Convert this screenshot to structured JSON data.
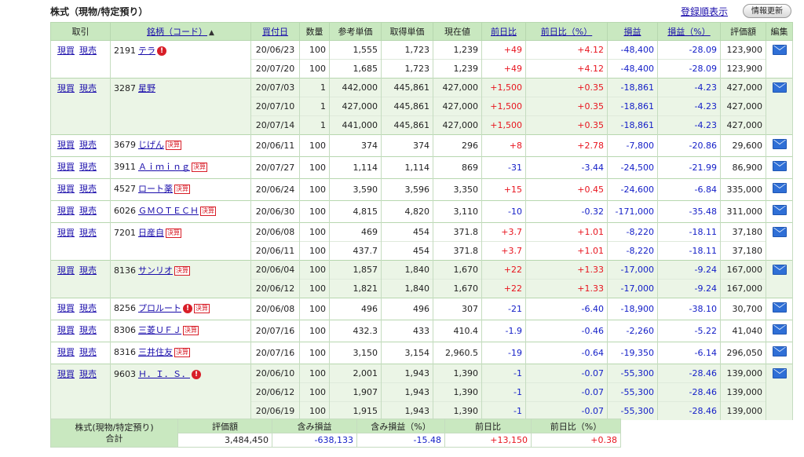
{
  "header": {
    "title": "株式（現物/特定預り）",
    "sort_link": "登録順表示",
    "refresh_button": "情報更新"
  },
  "columns": {
    "trade": "取引",
    "stock": "銘柄（コード）",
    "sort_indicator": "▲",
    "buy_date": "買付日",
    "quantity": "数量",
    "ref_price": "参考単価",
    "acq_price": "取得単価",
    "current": "現在値",
    "day_change": "前日比",
    "day_change_pct": "前日比（%）",
    "pnl": "損益",
    "pnl_pct": "損益（%）",
    "valuation": "評価額",
    "edit": "編集"
  },
  "actions": {
    "buy": "現買",
    "sell": "現売"
  },
  "badges": {
    "alert": "!",
    "kessan": "決算"
  },
  "colors": {
    "header_bg": "#c9e8c0",
    "alt_row_bg": "#ebf5e6",
    "positive": "#e8141e",
    "negative": "#1520c8"
  },
  "holdings": [
    {
      "code": "2191",
      "name": "テラ",
      "alert": true,
      "kessan": false,
      "alt": false,
      "rows": [
        {
          "date": "20/06/23",
          "qty": "100",
          "ref": "1,555",
          "acq": "1,723",
          "cur": "1,239",
          "chg": "+49",
          "chg_pct": "+4.12",
          "pnl": "-48,400",
          "pnl_pct": "-28.09",
          "val": "123,900"
        },
        {
          "date": "20/07/20",
          "qty": "100",
          "ref": "1,685",
          "acq": "1,723",
          "cur": "1,239",
          "chg": "+49",
          "chg_pct": "+4.12",
          "pnl": "-48,400",
          "pnl_pct": "-28.09",
          "val": "123,900"
        }
      ]
    },
    {
      "code": "3287",
      "name": "星野",
      "alert": false,
      "kessan": false,
      "alt": true,
      "rows": [
        {
          "date": "20/07/03",
          "qty": "1",
          "ref": "442,000",
          "acq": "445,861",
          "cur": "427,000",
          "chg": "+1,500",
          "chg_pct": "+0.35",
          "pnl": "-18,861",
          "pnl_pct": "-4.23",
          "val": "427,000"
        },
        {
          "date": "20/07/10",
          "qty": "1",
          "ref": "427,000",
          "acq": "445,861",
          "cur": "427,000",
          "chg": "+1,500",
          "chg_pct": "+0.35",
          "pnl": "-18,861",
          "pnl_pct": "-4.23",
          "val": "427,000"
        },
        {
          "date": "20/07/14",
          "qty": "1",
          "ref": "441,000",
          "acq": "445,861",
          "cur": "427,000",
          "chg": "+1,500",
          "chg_pct": "+0.35",
          "pnl": "-18,861",
          "pnl_pct": "-4.23",
          "val": "427,000"
        }
      ]
    },
    {
      "code": "3679",
      "name": "じげん",
      "alert": false,
      "kessan": true,
      "alt": false,
      "rows": [
        {
          "date": "20/06/11",
          "qty": "100",
          "ref": "374",
          "acq": "374",
          "cur": "296",
          "chg": "+8",
          "chg_pct": "+2.78",
          "pnl": "-7,800",
          "pnl_pct": "-20.86",
          "val": "29,600"
        }
      ]
    },
    {
      "code": "3911",
      "name": "Ａｉｍｉｎｇ",
      "alert": false,
      "kessan": true,
      "alt": false,
      "rows": [
        {
          "date": "20/07/27",
          "qty": "100",
          "ref": "1,114",
          "acq": "1,114",
          "cur": "869",
          "chg": "-31",
          "chg_pct": "-3.44",
          "pnl": "-24,500",
          "pnl_pct": "-21.99",
          "val": "86,900"
        }
      ]
    },
    {
      "code": "4527",
      "name": "ロート薬",
      "alert": false,
      "kessan": true,
      "alt": false,
      "rows": [
        {
          "date": "20/06/24",
          "qty": "100",
          "ref": "3,590",
          "acq": "3,596",
          "cur": "3,350",
          "chg": "+15",
          "chg_pct": "+0.45",
          "pnl": "-24,600",
          "pnl_pct": "-6.84",
          "val": "335,000"
        }
      ]
    },
    {
      "code": "6026",
      "name": "ＧＭＯＴＥＣＨ",
      "alert": false,
      "kessan": true,
      "alt": false,
      "rows": [
        {
          "date": "20/06/30",
          "qty": "100",
          "ref": "4,815",
          "acq": "4,820",
          "cur": "3,110",
          "chg": "-10",
          "chg_pct": "-0.32",
          "pnl": "-171,000",
          "pnl_pct": "-35.48",
          "val": "311,000"
        }
      ]
    },
    {
      "code": "7201",
      "name": "日産自",
      "alert": false,
      "kessan": true,
      "alt": false,
      "rows": [
        {
          "date": "20/06/08",
          "qty": "100",
          "ref": "469",
          "acq": "454",
          "cur": "371.8",
          "chg": "+3.7",
          "chg_pct": "+1.01",
          "pnl": "-8,220",
          "pnl_pct": "-18.11",
          "val": "37,180"
        },
        {
          "date": "20/06/11",
          "qty": "100",
          "ref": "437.7",
          "acq": "454",
          "cur": "371.8",
          "chg": "+3.7",
          "chg_pct": "+1.01",
          "pnl": "-8,220",
          "pnl_pct": "-18.11",
          "val": "37,180"
        }
      ]
    },
    {
      "code": "8136",
      "name": "サンリオ",
      "alert": false,
      "kessan": true,
      "alt": true,
      "rows": [
        {
          "date": "20/06/04",
          "qty": "100",
          "ref": "1,857",
          "acq": "1,840",
          "cur": "1,670",
          "chg": "+22",
          "chg_pct": "+1.33",
          "pnl": "-17,000",
          "pnl_pct": "-9.24",
          "val": "167,000"
        },
        {
          "date": "20/06/12",
          "qty": "100",
          "ref": "1,821",
          "acq": "1,840",
          "cur": "1,670",
          "chg": "+22",
          "chg_pct": "+1.33",
          "pnl": "-17,000",
          "pnl_pct": "-9.24",
          "val": "167,000"
        }
      ]
    },
    {
      "code": "8256",
      "name": "プロルート",
      "alert": true,
      "kessan": true,
      "alt": false,
      "rows": [
        {
          "date": "20/06/08",
          "qty": "100",
          "ref": "496",
          "acq": "496",
          "cur": "307",
          "chg": "-21",
          "chg_pct": "-6.40",
          "pnl": "-18,900",
          "pnl_pct": "-38.10",
          "val": "30,700"
        }
      ]
    },
    {
      "code": "8306",
      "name": "三菱ＵＦＪ",
      "alert": false,
      "kessan": true,
      "alt": false,
      "rows": [
        {
          "date": "20/07/16",
          "qty": "100",
          "ref": "432.3",
          "acq": "433",
          "cur": "410.4",
          "chg": "-1.9",
          "chg_pct": "-0.46",
          "pnl": "-2,260",
          "pnl_pct": "-5.22",
          "val": "41,040"
        }
      ]
    },
    {
      "code": "8316",
      "name": "三井住友",
      "alert": false,
      "kessan": true,
      "alt": false,
      "rows": [
        {
          "date": "20/07/16",
          "qty": "100",
          "ref": "3,150",
          "acq": "3,154",
          "cur": "2,960.5",
          "chg": "-19",
          "chg_pct": "-0.64",
          "pnl": "-19,350",
          "pnl_pct": "-6.14",
          "val": "296,050"
        }
      ]
    },
    {
      "code": "9603",
      "name": "Ｈ．Ｉ．Ｓ．",
      "alert": true,
      "kessan": false,
      "alt": true,
      "rows": [
        {
          "date": "20/06/10",
          "qty": "100",
          "ref": "2,001",
          "acq": "1,943",
          "cur": "1,390",
          "chg": "-1",
          "chg_pct": "-0.07",
          "pnl": "-55,300",
          "pnl_pct": "-28.46",
          "val": "139,000"
        },
        {
          "date": "20/06/12",
          "qty": "100",
          "ref": "1,907",
          "acq": "1,943",
          "cur": "1,390",
          "chg": "-1",
          "chg_pct": "-0.07",
          "pnl": "-55,300",
          "pnl_pct": "-28.46",
          "val": "139,000"
        },
        {
          "date": "20/06/19",
          "qty": "100",
          "ref": "1,915",
          "acq": "1,943",
          "cur": "1,390",
          "chg": "-1",
          "chg_pct": "-0.07",
          "pnl": "-55,300",
          "pnl_pct": "-28.46",
          "val": "139,000"
        }
      ]
    }
  ],
  "summary": {
    "label_line1": "株式(現物/特定預り)",
    "label_line2": "合計",
    "headers": {
      "valuation": "評価額",
      "unrealized_pnl": "含み損益",
      "unrealized_pnl_pct": "含み損益（%）",
      "day_change": "前日比",
      "day_change_pct": "前日比（%）"
    },
    "values": {
      "valuation": "3,484,450",
      "unrealized_pnl": "-638,133",
      "unrealized_pnl_pct": "-15.48",
      "day_change": "+13,150",
      "day_change_pct": "+0.38"
    }
  }
}
